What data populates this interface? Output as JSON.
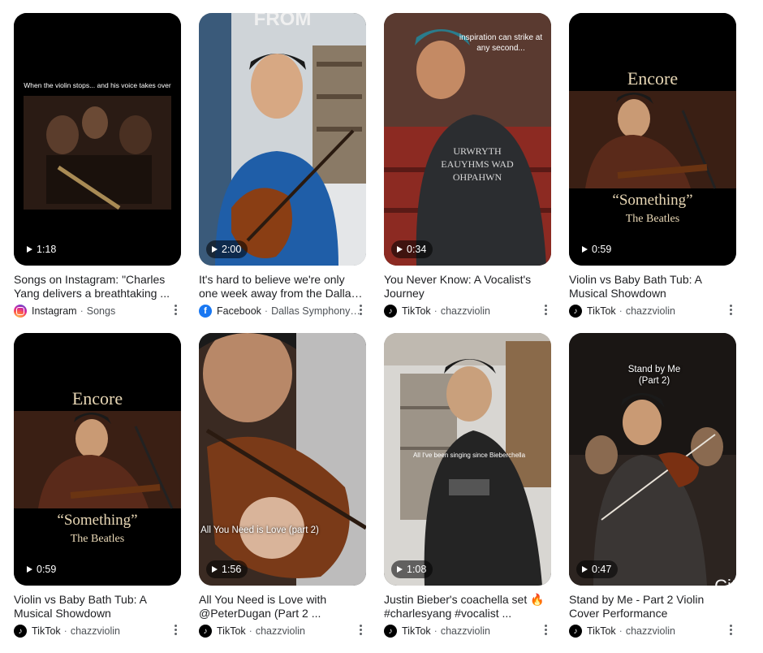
{
  "cards": [
    {
      "duration": "1:18",
      "title": "Songs on Instagram: \"Charles Yang delivers a breathtaking ...",
      "source": "Instagram",
      "channel": "Songs",
      "logo": "instagram-logo",
      "overlay": "When the violin stops... and his voice takes over"
    },
    {
      "duration": "2:00",
      "title": "It's hard to believe we're only one week away from the Dallas ...",
      "source": "Facebook",
      "channel": "Dallas Symphony ...",
      "logo": "facebook-logo",
      "overlay": "FROM"
    },
    {
      "duration": "0:34",
      "title": "You Never Know: A Vocalist's Journey",
      "source": "TikTok",
      "channel": "chazzviolin",
      "logo": "tiktok-logo",
      "overlay": "inspiration can strike at any second...",
      "shirt": "URWRYTH EAUYHMS WAD OHPAHWN"
    },
    {
      "duration": "0:59",
      "title": "Violin vs Baby Bath Tub: A Musical Showdown",
      "source": "TikTok",
      "channel": "chazzviolin",
      "logo": "tiktok-logo",
      "overlay": "Encore",
      "song": "“Something”",
      "artist": "The Beatles"
    },
    {
      "duration": "0:59",
      "title": "Violin vs Baby Bath Tub: A Musical Showdown",
      "source": "TikTok",
      "channel": "chazzviolin",
      "logo": "tiktok-logo",
      "overlay": "Encore",
      "song": "“Something”",
      "artist": "The Beatles"
    },
    {
      "duration": "1:56",
      "title": "All You Need is Love with @PeterDugan (Part 2 ...",
      "source": "TikTok",
      "channel": "chazzviolin",
      "logo": "tiktok-logo",
      "overlay": "All You Need is Love (part 2)"
    },
    {
      "duration": "1:08",
      "title": "Justin Bieber's coachella set 🔥 #charlesyang #vocalist ...",
      "source": "TikTok",
      "channel": "chazzviolin",
      "logo": "tiktok-logo",
      "overlay": "All I've been singing since Bieberchella"
    },
    {
      "duration": "0:47",
      "title": "Stand by Me - Part 2 Violin Cover Performance",
      "source": "TikTok",
      "channel": "chazzviolin",
      "logo": "tiktok-logo",
      "overlay": "Stand by Me (Part 2)"
    }
  ],
  "watermark": "City"
}
